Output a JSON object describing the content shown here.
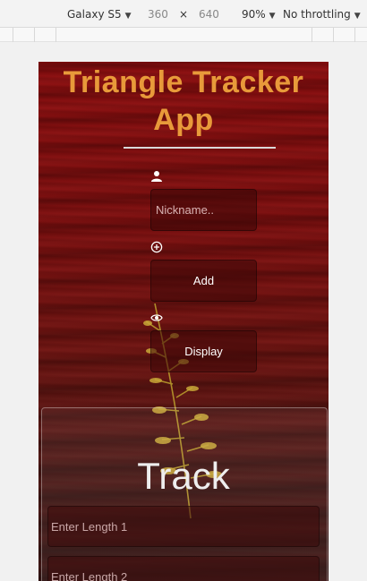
{
  "devtools": {
    "device": "Galaxy S5",
    "width": "360",
    "times": "×",
    "height": "640",
    "zoom": "90%",
    "throttle": "No throttling"
  },
  "app": {
    "title": "Triangle Tracker App",
    "nickname_placeholder": "Nickname..",
    "add_label": "Add",
    "display_label": "Display",
    "track_title": "Track",
    "length1_placeholder": "Enter Length 1",
    "length2_placeholder": "Enter Length 2"
  },
  "colors": {
    "title": "#e89a3a",
    "background": "#7b1010"
  },
  "icons": {
    "user": "person-icon",
    "add": "plus-circle-icon",
    "display": "eye-icon"
  }
}
